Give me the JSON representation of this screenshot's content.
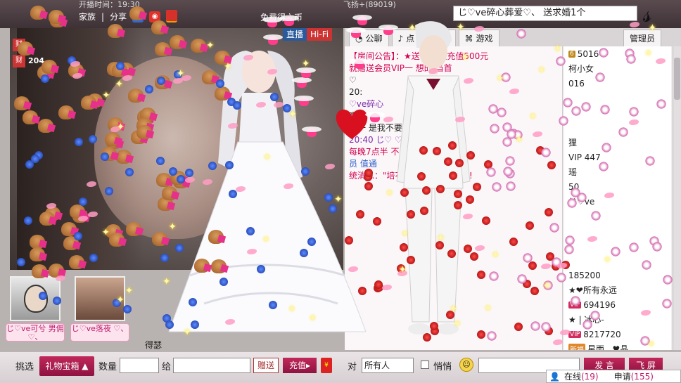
{
  "topbar": {
    "broadcast_time": "开播时间：19:30",
    "nav": {
      "family": "家族",
      "share": "分享"
    },
    "get_coins": "免费得六币",
    "user_id": "飞扬+(89019)"
  },
  "video": {
    "tabs": {
      "live": "直播",
      "hifi": "Hi-Fi"
    },
    "badge_top": "财",
    "badge_bottom": "财",
    "number": "204,"
  },
  "avatars": [
    {
      "name": "じ♡ve可兮 男佣♡、"
    },
    {
      "name": "じ♡ve落夜 ♡、"
    }
  ],
  "singer_name": "得瑟",
  "banner": {
    "text": "じ♡ve碎心葬爱♡、  送求婚1个"
  },
  "right": {
    "tabs": [
      {
        "label": "公聊",
        "icon": "chat-icon"
      },
      {
        "label": "点",
        "icon": "song-icon"
      },
      {
        "label": "礼",
        "icon": "gift-icon"
      },
      {
        "label": "游戏",
        "icon": "game-icon"
      },
      {
        "label": "管理员",
        "icon": "admin-icon"
      }
    ],
    "chat": [
      {
        "text": "【房间公告】：★送 ★一次充值500元",
        "cls": "red"
      },
      {
        "text": "就赠送会员VIP一 想的 当首",
        "cls": "red"
      },
      {
        "text": "♡",
        "cls": ""
      },
      {
        "text": "20:",
        "cls": ""
      },
      {
        "text": "",
        "cls": ""
      },
      {
        "text": "",
        "cls": ""
      },
      {
        "text": "",
        "cls": ""
      },
      {
        "text": "",
        "cls": ""
      },
      {
        "text": "",
        "cls": ""
      },
      {
        "text": "",
        "cls": ""
      },
      {
        "text": "♡ve碎心",
        "cls": "purple"
      },
      {
        "text": "嗯",
        "cls": ""
      },
      {
        "text": "鸣一 是我不要你嘛",
        "cls": ""
      },
      {
        "text": "20:40 じ♡ ♡ve碎心",
        "cls": "purple"
      },
      {
        "text": "",
        "cls": ""
      },
      {
        "text": "",
        "cls": ""
      },
      {
        "text": "每晚7点半 不",
        "cls": "red"
      },
      {
        "text": "",
        "cls": ""
      },
      {
        "text": "",
        "cls": ""
      },
      {
        "text": "员 值通",
        "cls": "blue"
      },
      {
        "text": "",
        "cls": ""
      },
      {
        "text": "统消息：\"培花水壶\" 中无限六币!",
        "cls": "red"
      }
    ],
    "users": [
      {
        "lvl": "6",
        "name": "5016",
        "badge": ""
      },
      {
        "lvl": "",
        "name": "柯小女",
        "badge": ""
      },
      {
        "lvl": "",
        "name": "016",
        "badge": ""
      },
      {
        "lvl": "",
        "name": "",
        "badge": ""
      },
      {
        "lvl": "",
        "name": "",
        "badge": ""
      },
      {
        "lvl": "",
        "name": "",
        "badge": ""
      },
      {
        "lvl": "",
        "name": "狸",
        "badge": ""
      },
      {
        "lvl": "",
        "name": "VIP 447",
        "badge": ""
      },
      {
        "lvl": "",
        "name": "瑶",
        "badge": ""
      },
      {
        "lvl": "",
        "name": "50",
        "badge": ""
      },
      {
        "lvl": "",
        "name": "じ♡ve",
        "badge": ""
      },
      {
        "lvl": "",
        "name": "",
        "badge": ""
      },
      {
        "lvl": "",
        "name": "",
        "badge": ""
      },
      {
        "lvl": "",
        "name": "",
        "badge": ""
      },
      {
        "lvl": "",
        "name": "",
        "badge": ""
      },
      {
        "lvl": "",
        "name": "185200",
        "badge": ""
      },
      {
        "lvl": "",
        "name": "★❤所有永远",
        "badge": ""
      },
      {
        "lvl": "",
        "name": "694196",
        "badge": "VIP"
      },
      {
        "lvl": "",
        "name": "★ | 冰心-",
        "badge": ""
      },
      {
        "lvl": "",
        "name": "8217720",
        "badge": "VIP"
      },
      {
        "lvl": "",
        "name": "星雨...♥晶",
        "badge": "新福"
      }
    ]
  },
  "giftbar": {
    "pick": "挑选",
    "gift_box": "礼物宝箱",
    "quantity": "数量",
    "give": "给",
    "send": "赠送",
    "recharge": "充值",
    "to": "对",
    "target": "所有人",
    "whisper": "悄悄",
    "speak": "发 言",
    "fly": "飞 屏"
  },
  "status": {
    "online_label": "在线",
    "online_count": "(19)",
    "apply_label": "申请",
    "apply_count": "(155)"
  },
  "colors": {
    "accent": "#b01e52",
    "topbar": "#4a3d41",
    "panel": "#f1eef0"
  }
}
